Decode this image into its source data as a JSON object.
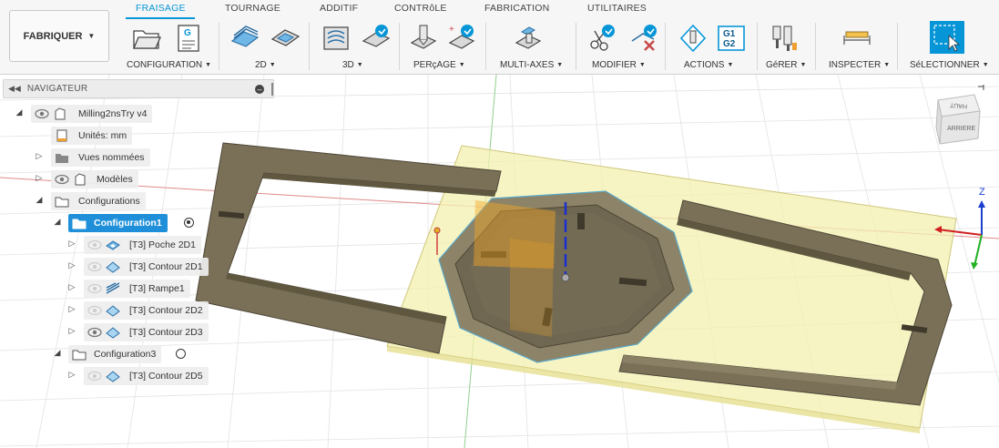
{
  "workspace": {
    "label": "FABRIQUER"
  },
  "tabs": [
    {
      "label": "FRAISAGE",
      "active": true
    },
    {
      "label": "TOURNAGE",
      "active": false
    },
    {
      "label": "ADDITIF",
      "active": false
    },
    {
      "label": "CONTRôLE",
      "active": false
    },
    {
      "label": "FABRICATION",
      "active": false
    },
    {
      "label": "UTILITAIRES",
      "active": false
    }
  ],
  "groups": [
    {
      "label": "CONFIGURATION"
    },
    {
      "label": "2D"
    },
    {
      "label": "3D"
    },
    {
      "label": "PERçAGE"
    },
    {
      "label": "MULTI-AXES"
    },
    {
      "label": "MODIFIER"
    },
    {
      "label": "ACTIONS"
    },
    {
      "label": "GéRER"
    },
    {
      "label": "INSPECTER"
    },
    {
      "label": "SéLECTIONNER"
    }
  ],
  "icons": {
    "setup": "folder-setup-icon",
    "gcode": "g-code-list-icon",
    "g1g2": "G1\nG2"
  },
  "browser": {
    "title": "NAVIGATEUR",
    "root": "Milling2nsTry v4",
    "units": "Unités: mm",
    "named_views": "Vues nommées",
    "models": "Modèles",
    "setups": "Configurations",
    "setup1": "Configuration1",
    "ops": [
      "[T3] Poche 2D1",
      "[T3] Contour 2D1",
      "[T3] Rampe1",
      "[T3] Contour 2D2",
      "[T3] Contour 2D3"
    ],
    "setup3": "Configuration3",
    "setup3_ops": [
      "[T3] Contour 2D5"
    ]
  },
  "viewcube": {
    "top": "HAUT",
    "front": "ARRIERE"
  },
  "triad": {
    "z": "Z"
  },
  "colors": {
    "accent": "#0696d7",
    "selection": "#1e8fd8",
    "stock": "#f4f0b0",
    "part": "#7a7058"
  }
}
